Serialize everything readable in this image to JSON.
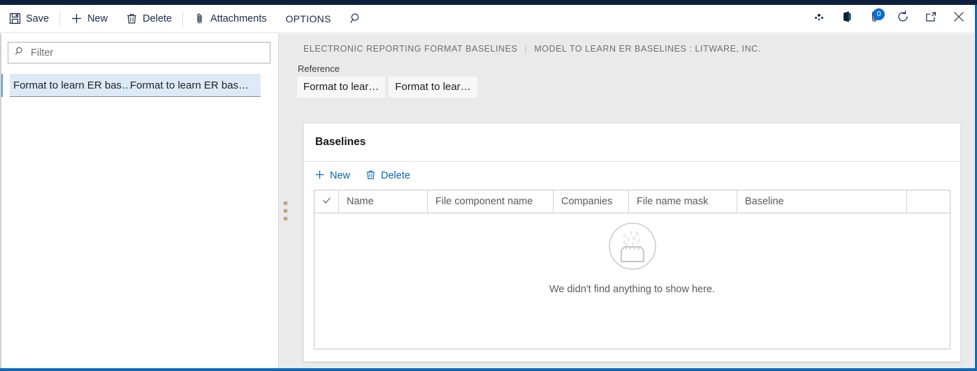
{
  "commandbar": {
    "buttons": [
      {
        "label": "Save",
        "icon": "save-icon"
      },
      {
        "label": "New",
        "icon": "plus-icon"
      },
      {
        "label": "Delete",
        "icon": "trash-icon"
      },
      {
        "label": "Attachments",
        "icon": "paperclip-icon"
      }
    ],
    "options_label": "OPTIONS",
    "search_icon": "search-icon",
    "system_icons": [
      {
        "name": "settings-diamond-icon"
      },
      {
        "name": "office-app-icon"
      },
      {
        "name": "attachments-icon",
        "badge": "0"
      },
      {
        "name": "refresh-icon"
      },
      {
        "name": "open-in-new-window-icon"
      },
      {
        "name": "close-icon"
      }
    ]
  },
  "sidebar": {
    "filter_placeholder": "Filter",
    "filter_value": "",
    "items": [
      {
        "col1": "Format to learn ER bas…",
        "col2": "Format to learn ER bas…",
        "selected": true
      }
    ]
  },
  "breadcrumb": {
    "root": "ELECTRONIC REPORTING FORMAT BASELINES",
    "separator": "|",
    "current": "MODEL TO LEARN ER BASELINES : LITWARE, INC."
  },
  "reference": {
    "label": "Reference",
    "chips": [
      "Format to lear…",
      "Format to lear…"
    ]
  },
  "card": {
    "title": "Baselines",
    "toolbar": [
      {
        "label": "New",
        "icon": "plus-icon"
      },
      {
        "label": "Delete",
        "icon": "trash-icon"
      }
    ],
    "grid": {
      "select_all_icon": "checkmark-icon",
      "columns": [
        "Name",
        "File component name",
        "Companies",
        "File name mask",
        "Baseline"
      ],
      "rows": [],
      "empty_state": {
        "icon": "empty-folder-binary-icon",
        "message": "We didn't find anything to show here."
      }
    }
  },
  "colors": {
    "navy": "#0e1f3d",
    "accent_blue": "#1268b3",
    "link_blue": "#0a65b0",
    "badge_blue": "#0a6ed1",
    "selection_blue": "#dceaf7",
    "panel_gray": "#eaeaea"
  }
}
